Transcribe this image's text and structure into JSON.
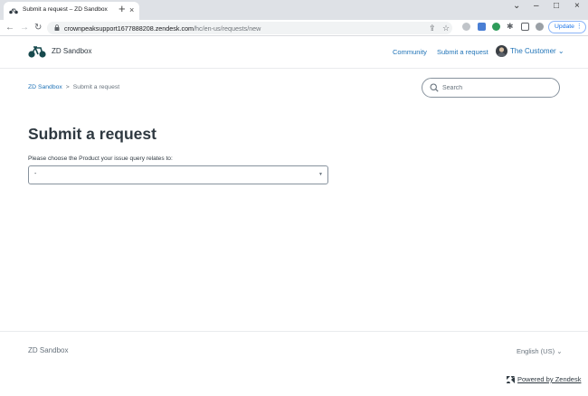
{
  "browser": {
    "tab_title": "Submit a request – ZD Sandbox",
    "close_glyph": "×",
    "new_tab_glyph": "+",
    "url_host": "crownpeaksupport1677888208.zendesk.com",
    "url_path": "/hc/en-us/requests/new",
    "update_label": "Update",
    "window_controls": {
      "minimize": "–",
      "maximize": "□",
      "close": "×",
      "more": "⌄"
    },
    "nav": {
      "back": "←",
      "forward": "→",
      "reload": "↻"
    }
  },
  "header": {
    "brand": "ZD Sandbox",
    "nav": {
      "community": "Community",
      "submit_request": "Submit a request"
    },
    "user_name": "The Customer",
    "user_caret": "⌄"
  },
  "breadcrumb": {
    "home": "ZD Sandbox",
    "separator": ">",
    "current": "Submit a request"
  },
  "search": {
    "placeholder": "Search"
  },
  "main": {
    "title": "Submit a request",
    "field_label": "Please choose the Product your issue query relates to:",
    "select_value": "-",
    "select_caret": "▼"
  },
  "footer": {
    "brand": "ZD Sandbox",
    "language": "English (US)",
    "language_caret": "⌄",
    "powered_by": "Powered by Zendesk"
  },
  "colors": {
    "link": "#1f73b7",
    "text": "#2f3941",
    "muted": "#68737d",
    "border": "#87929d",
    "chrome_tabbar": "#dee1e6"
  },
  "icons": {
    "tab_favicon": "bicycle-icon",
    "logo": "bicycle-logo-icon",
    "search": "search-icon",
    "lock": "lock-icon",
    "zendesk": "zendesk-logo-icon"
  }
}
